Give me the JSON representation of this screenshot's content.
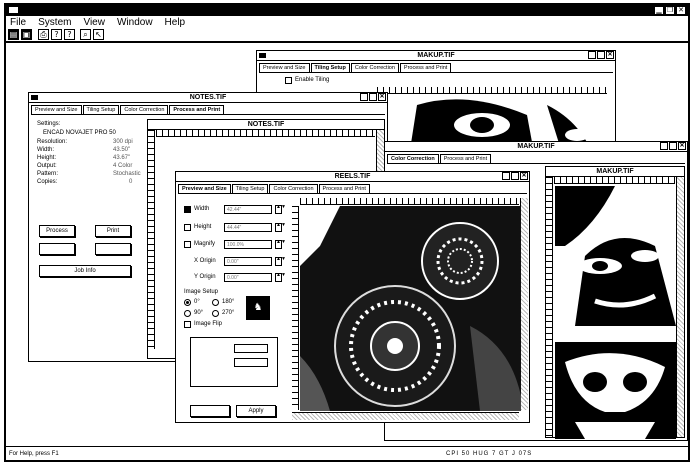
{
  "app": {
    "menus": [
      "File",
      "System",
      "View",
      "Window",
      "Help"
    ],
    "toolbar_icons": [
      "open-icon",
      "save-icon",
      "print-icon",
      "help-icon",
      "context-help-icon",
      "zoom-icon",
      "pointer-icon"
    ],
    "status_left": "For Help, press F1",
    "status_right": "CPI 50 HUG 7 GT J 07S"
  },
  "makup_back": {
    "title": "MAKUP.TIF",
    "tabs": [
      "Preview and Size",
      "Tiling Setup",
      "Color Correction",
      "Process and Print"
    ],
    "enable_tiling": "Enable Tiling"
  },
  "notes": {
    "title": "NOTES.TIF",
    "tabs": [
      "Preview and Size",
      "Tiling Setup",
      "Color Correction",
      "Process and Print"
    ],
    "settings_label": "Settings:",
    "printer": "ENCAD NOVAJET PRO 50",
    "rows": [
      {
        "label": "Resolution:",
        "value": "300 dpi"
      },
      {
        "label": "Width:",
        "value": "43.50\""
      },
      {
        "label": "Height:",
        "value": "43.67\""
      },
      {
        "label": "Output:",
        "value": "4 Color"
      },
      {
        "label": "Pattern:",
        "value": "Stochastic"
      },
      {
        "label": "Copies:",
        "value": "0"
      }
    ],
    "process_button": "Process",
    "print_button": "Print",
    "job_info_button": "Job Info",
    "preview_title": "NOTES.TIF"
  },
  "makup_mid": {
    "title": "MAKUP.TIF",
    "tabs": [
      "Color Correction",
      "Process and Print"
    ],
    "preview_title": "MAKUP.TIF"
  },
  "reels": {
    "title": "REELS.TIF",
    "tabs": [
      "Preview and Size",
      "Tiling Setup",
      "Color Correction",
      "Process and Print"
    ],
    "fields": [
      {
        "label": "Width",
        "value": "42.44\""
      },
      {
        "label": "Height",
        "value": "44.44\""
      },
      {
        "label": "Magnify",
        "value": "100.0%"
      },
      {
        "label": "X Origin",
        "value": "0.00\""
      },
      {
        "label": "Y Origin",
        "value": "0.00\""
      }
    ],
    "image_setup": "Image Setup",
    "rot0": "0°",
    "rot180": "180°",
    "rot90": "90°",
    "rot270": "270°",
    "image_flip": "Image Flip",
    "apply_button": "Apply"
  },
  "colors": {
    "ink": "#000000",
    "paper": "#ffffff",
    "photo": "#111111"
  }
}
